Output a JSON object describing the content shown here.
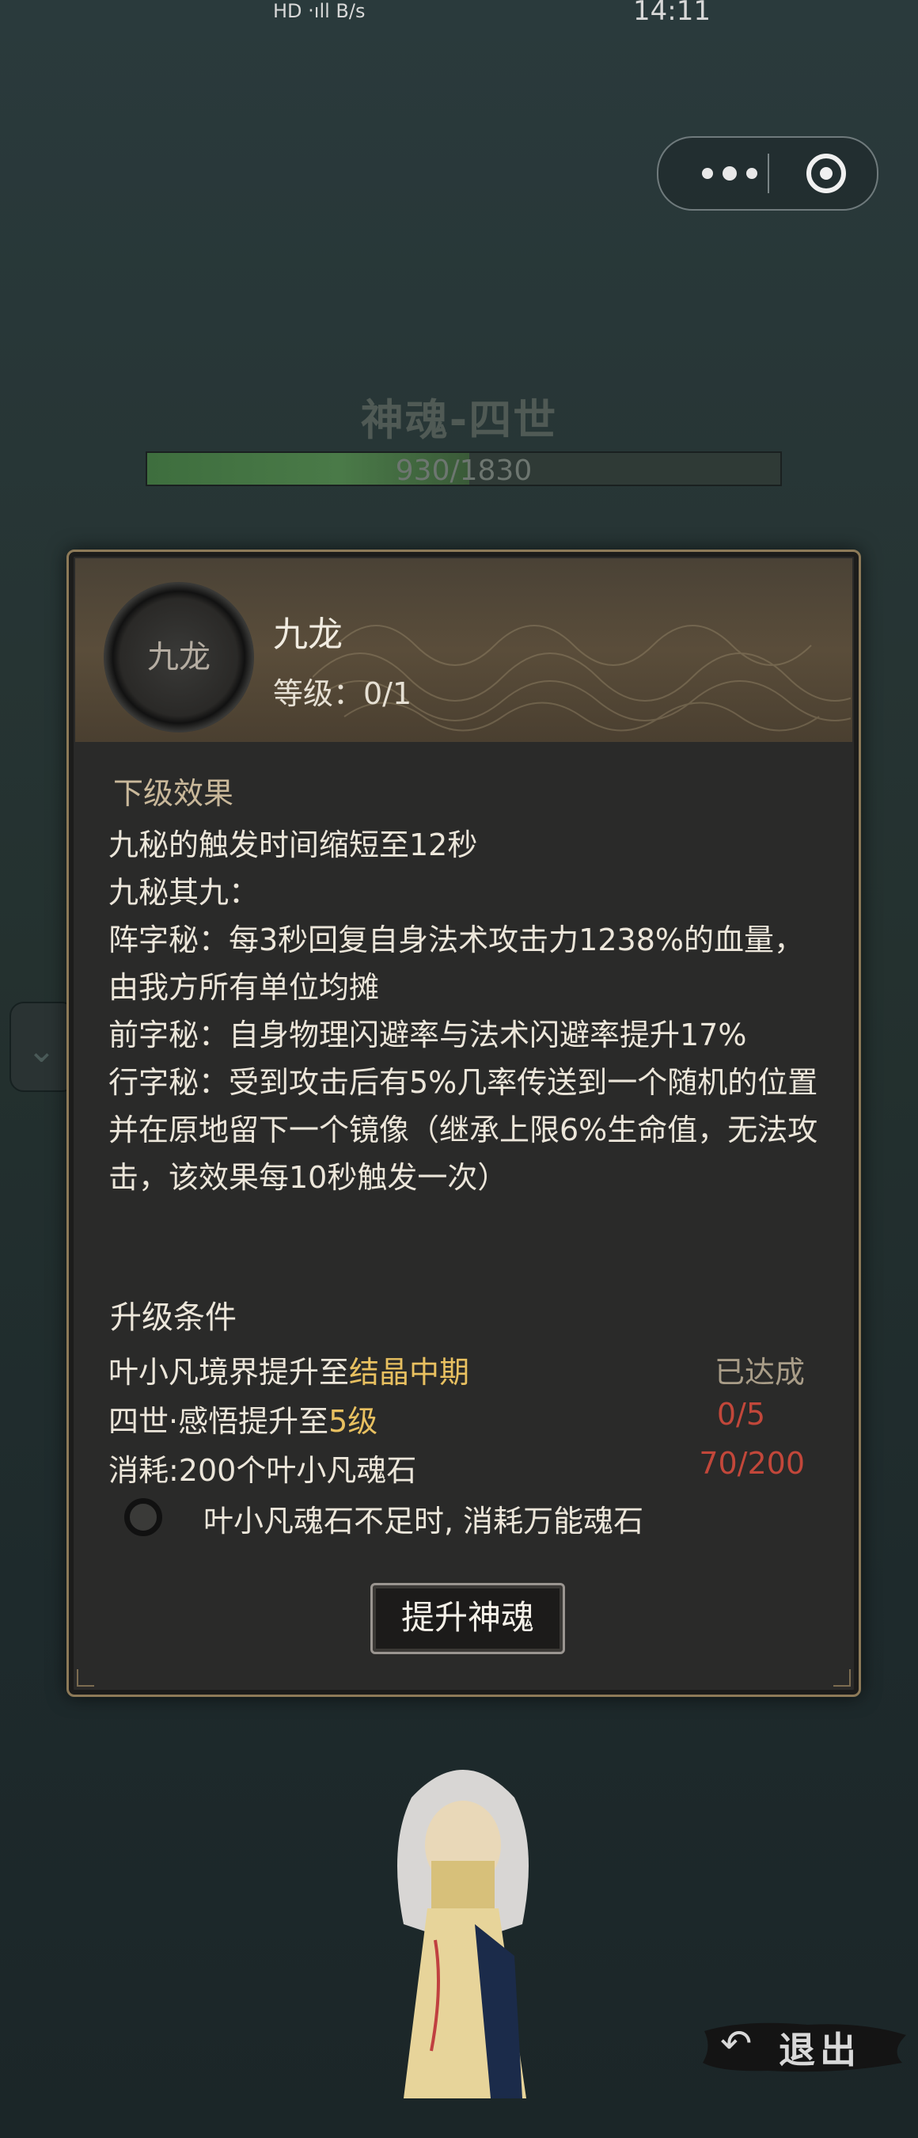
{
  "status_bar": {
    "left_text": "HD ‧ıll B/s",
    "time": "14:11"
  },
  "background": {
    "title": "神魂-四世",
    "progress_text": "930/1830",
    "progress_value": 930,
    "progress_max": 1830
  },
  "dialog": {
    "avatar_label": "九龙",
    "skill_name": "九龙",
    "level_text": "等级：0/1",
    "effect_title": "下级效果",
    "effect_lines": [
      "九秘的触发时间缩短至12秒",
      "九秘其九：",
      "阵字秘：每3秒回复自身法术攻击力1238%的血量，由我方所有单位均摊",
      "前字秘：自身物理闪避率与法术闪避率提升17%",
      "行字秘：受到攻击后有5%几率传送到一个随机的位置并在原地留下一个镜像（继承上限6%生命值，无法攻击，该效果每10秒触发一次）"
    ],
    "upgrade_title": "升级条件",
    "conditions": [
      {
        "prefix": "叶小凡境界提升至",
        "highlight": "结晶中期",
        "value": "已达成"
      },
      {
        "prefix": "四世·感悟提升至",
        "highlight": "5级",
        "value": "0/5"
      },
      {
        "prefix": "消耗:200个叶小凡魂石",
        "highlight": "",
        "value": "70/200"
      }
    ],
    "toggle_label": "叶小凡魂石不足时, 消耗万能魂石",
    "upgrade_button": "提升神魂"
  },
  "exit_button": "退出",
  "colors": {
    "gold": "#e8c060",
    "red": "#c2473a",
    "gray": "#a99d88"
  }
}
